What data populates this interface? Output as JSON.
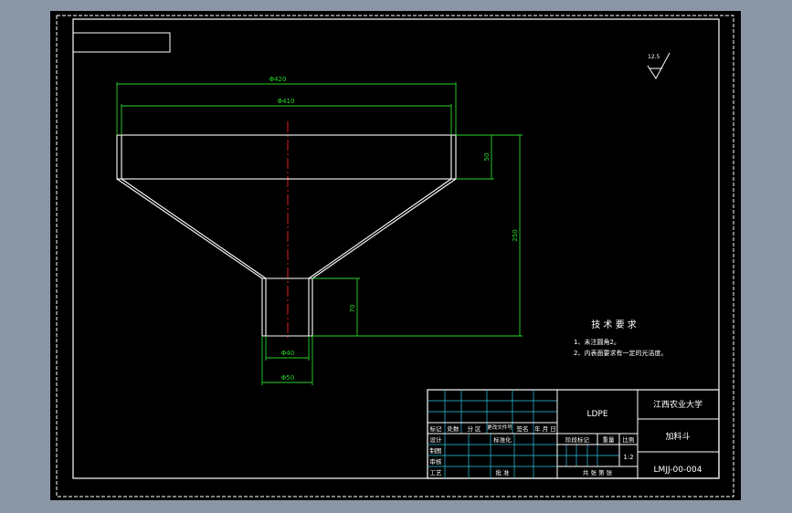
{
  "drawing": {
    "roughness_symbol": "12.5",
    "dimensions": {
      "top_outer_diameter": "Φ420",
      "top_inner_diameter": "Φ410",
      "rim_height": "50",
      "overall_height": "250",
      "spout_height": "70",
      "spout_inner_diameter": "Φ40",
      "spout_outer_diameter": "Φ50"
    },
    "technical_requirements": {
      "title": "技 术 要 求",
      "items": [
        "1、未注圆角2。",
        "2、内表面要求有一定的光洁度。"
      ]
    },
    "title_block": {
      "material": "LDPE",
      "organization": "江西农业大学",
      "part_name": "加料斗",
      "drawing_number": "LMJJ-00-004",
      "scale": "1:2",
      "col_headers": [
        "标记",
        "处数",
        "分 区",
        "更改文件号",
        "签名",
        "年 月 日"
      ],
      "row_labels": [
        "设计",
        "制图",
        "审核",
        "工艺"
      ],
      "standardization": "标准化",
      "approval": "批 准",
      "stage_mark": "阶段标记",
      "weight": "重量",
      "scale_label": "比例",
      "sheets": "共 张 第 张"
    }
  }
}
